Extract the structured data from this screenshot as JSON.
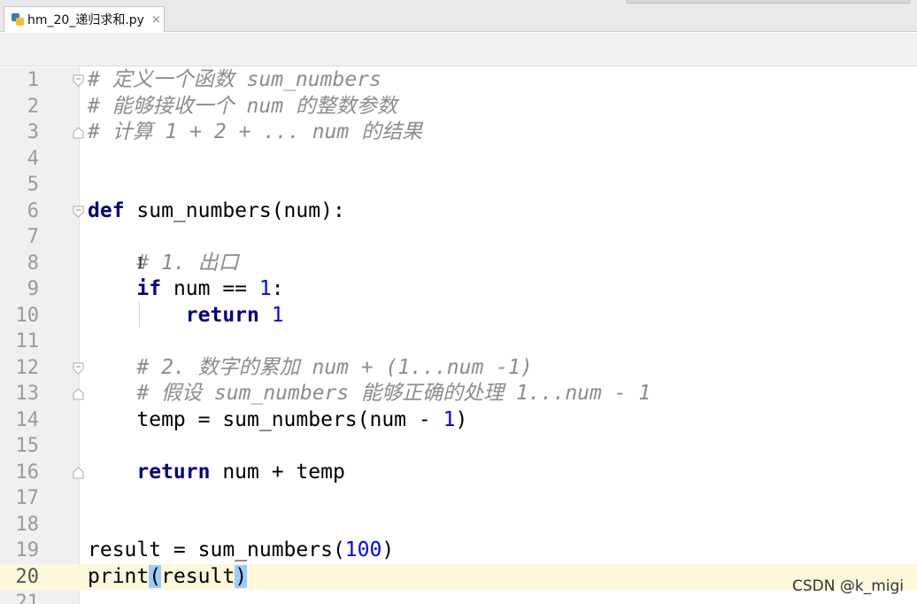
{
  "tab": {
    "icon": "python-file-icon",
    "title": "hm_20_递归求和.py",
    "close": "×"
  },
  "lines": [
    {
      "n": "1",
      "fold": "start",
      "current": false,
      "parts": [
        {
          "t": "# 定义一个函数 sum_numbers",
          "c": "cm"
        }
      ]
    },
    {
      "n": "2",
      "fold": "",
      "current": false,
      "parts": [
        {
          "t": "# 能够接收一个 num 的整数参数",
          "c": "cm"
        }
      ]
    },
    {
      "n": "3",
      "fold": "end",
      "current": false,
      "parts": [
        {
          "t": "# 计算 1 + 2 + ... num 的结果",
          "c": "cm"
        }
      ]
    },
    {
      "n": "4",
      "fold": "",
      "current": false,
      "parts": []
    },
    {
      "n": "5",
      "fold": "",
      "current": false,
      "parts": []
    },
    {
      "n": "6",
      "fold": "start",
      "current": false,
      "parts": [
        {
          "t": "def",
          "c": "kw"
        },
        {
          "t": " sum_numbers(num):",
          "c": ""
        }
      ]
    },
    {
      "n": "7",
      "fold": "",
      "current": false,
      "parts": []
    },
    {
      "n": "8",
      "fold": "",
      "current": false,
      "parts": [
        {
          "t": "    ",
          "c": ""
        },
        {
          "t": "# 1. 出口",
          "c": "cm"
        }
      ]
    },
    {
      "n": "9",
      "fold": "",
      "current": false,
      "parts": [
        {
          "t": "    ",
          "c": ""
        },
        {
          "t": "if",
          "c": "kw"
        },
        {
          "t": " num == ",
          "c": ""
        },
        {
          "t": "1",
          "c": "num"
        },
        {
          "t": ":",
          "c": ""
        }
      ]
    },
    {
      "n": "10",
      "fold": "",
      "current": false,
      "parts": [
        {
          "t": "        ",
          "c": ""
        },
        {
          "t": "return",
          "c": "kw"
        },
        {
          "t": " ",
          "c": ""
        },
        {
          "t": "1",
          "c": "num"
        }
      ]
    },
    {
      "n": "11",
      "fold": "",
      "current": false,
      "parts": []
    },
    {
      "n": "12",
      "fold": "start",
      "current": false,
      "parts": [
        {
          "t": "    ",
          "c": ""
        },
        {
          "t": "# 2. 数字的累加 num + (1...num -1)",
          "c": "cm"
        }
      ]
    },
    {
      "n": "13",
      "fold": "end",
      "current": false,
      "parts": [
        {
          "t": "    ",
          "c": ""
        },
        {
          "t": "# 假设 sum_numbers 能够正确的处理 1...num - 1",
          "c": "cm"
        }
      ]
    },
    {
      "n": "14",
      "fold": "",
      "current": false,
      "parts": [
        {
          "t": "    temp = sum_numbers(num - ",
          "c": ""
        },
        {
          "t": "1",
          "c": "num"
        },
        {
          "t": ")",
          "c": ""
        }
      ]
    },
    {
      "n": "15",
      "fold": "",
      "current": false,
      "parts": []
    },
    {
      "n": "16",
      "fold": "end",
      "current": false,
      "parts": [
        {
          "t": "    ",
          "c": ""
        },
        {
          "t": "return",
          "c": "kw"
        },
        {
          "t": " num + temp",
          "c": ""
        }
      ]
    },
    {
      "n": "17",
      "fold": "",
      "current": false,
      "parts": []
    },
    {
      "n": "18",
      "fold": "",
      "current": false,
      "parts": []
    },
    {
      "n": "19",
      "fold": "",
      "current": false,
      "parts": [
        {
          "t": "result = sum_numbers(",
          "c": ""
        },
        {
          "t": "100",
          "c": "num"
        },
        {
          "t": ")",
          "c": ""
        }
      ]
    },
    {
      "n": "20",
      "fold": "",
      "current": true,
      "parts": [
        {
          "t": "print",
          "c": ""
        },
        {
          "t": "(",
          "c": "paren-hl"
        },
        {
          "t": "result",
          "c": ""
        },
        {
          "t": ")",
          "c": "paren-hl"
        }
      ]
    },
    {
      "n": "21",
      "fold": "",
      "current": false,
      "parts": []
    }
  ],
  "watermark": "CSDN @k_migi",
  "colors": {
    "keyword": "#000080",
    "number": "#0000ff",
    "comment": "#8c8c8c",
    "current_line": "#fdf8d9",
    "brace_match": "#99ccff"
  }
}
